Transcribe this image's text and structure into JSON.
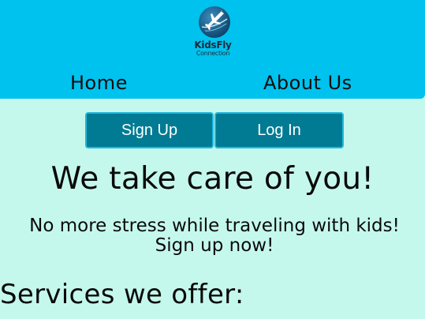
{
  "logo": {
    "name": "KidsFly",
    "subtitle": "Connection",
    "icon": "airplane-globe-icon"
  },
  "nav": {
    "home_label": "Home",
    "about_label": "About Us"
  },
  "buttons": {
    "signup_label": "Sign Up",
    "login_label": "Log In"
  },
  "hero": {
    "title": "We take care of you!",
    "subtitle_line1": "No more stress while traveling with kids!",
    "subtitle_line2": "Sign up now!"
  },
  "services": {
    "title": "Services we offer:"
  },
  "colors": {
    "header_bg": "#00c2ee",
    "page_bg": "#c5f8ec",
    "button_bg": "#007b93",
    "button_border": "#1fb8e0"
  }
}
